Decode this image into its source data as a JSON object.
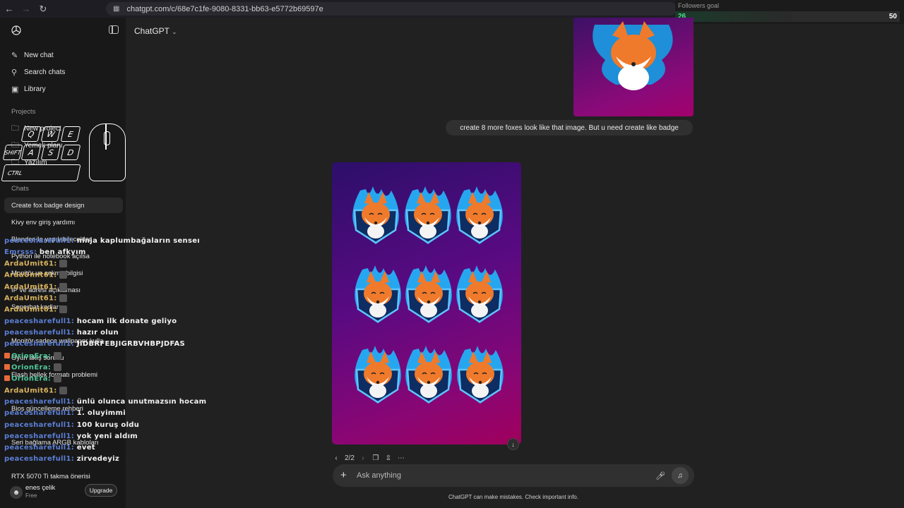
{
  "browser": {
    "url": "chatgpt.com/c/68e7c1fe-9080-8331-bb63-e5772b69597e",
    "back_icon": "back-arrow-icon",
    "forward_icon": "forward-arrow-icon",
    "reload_icon": "reload-icon"
  },
  "followers_goal": {
    "title": "Followers goal",
    "current": "26",
    "goal": "50",
    "progress_fraction": 0.52
  },
  "sidebar": {
    "new_chat": "New chat",
    "search_chats": "Search chats",
    "library": "Library",
    "projects_heading": "Projects",
    "projects": [
      "New project",
      "Yemek planı",
      "Yazılım"
    ],
    "chats_heading": "Chats",
    "chats": [
      "Create fox badge design",
      "Kivy env giriş yardımı",
      "Blender ile yapılabilecekler",
      "Python ile notebook açılsa",
      "Monitör ve sekme bilgisi",
      "IP ve adresi açıklaması",
      "Sonerbat kodları",
      "Monitör sadece wallpaper kulla",
      "Oyun akış sorunu",
      "Flash bellek formatı problemi",
      "Bios güncelleme rehberi",
      "Seri bağlama ARGB kabloları",
      "RTX 5070 Ti takma önerisi"
    ],
    "user_name": "enes çelik",
    "user_plan": "Free",
    "upgrade_label": "Upgrade"
  },
  "main": {
    "model_title": "ChatGPT",
    "user_message": "create 8 more foxes look like that image. But u need create like badge",
    "pager": "2/2",
    "composer_placeholder": "Ask anything",
    "disclaimer": "ChatGPT can make mistakes. Check important info."
  },
  "stream_overlay": {
    "keys": [
      "Q",
      "W",
      "E",
      "SHIFT",
      "A",
      "S",
      "D",
      "CTRL"
    ],
    "chat_lines": [
      {
        "name": "peacesharefull1:",
        "msg": "ninja kaplumbağaların senseı",
        "color": "blue"
      },
      {
        "name": "Emrsss:",
        "msg": "ben afkyım",
        "color": "blue"
      },
      {
        "name": "ArdaUmit61:",
        "msg": "",
        "color": "gold"
      },
      {
        "name": "ArdaUmit61:",
        "msg": "",
        "color": "gold"
      },
      {
        "name": "ArdaUmit61:",
        "msg": "",
        "color": "gold"
      },
      {
        "name": "ArdaUmit61:",
        "msg": "",
        "color": "gold"
      },
      {
        "name": "ArdaUmit61:",
        "msg": "",
        "color": "gold"
      },
      {
        "name": "peacesharefull1:",
        "msg": "hocam ilk donate geliyo",
        "color": "blue"
      },
      {
        "name": "peacesharefull1:",
        "msg": "hazır olun",
        "color": "blue"
      },
      {
        "name": "peacesharefull1:",
        "msg": "JIDBRFEBJIGRBVHBPJDFAS",
        "color": "blue"
      },
      {
        "name": "OrionEra:",
        "msg": "",
        "color": "green"
      },
      {
        "name": "OrionEra:",
        "msg": "",
        "color": "green"
      },
      {
        "name": "OrionEra:",
        "msg": "",
        "color": "green"
      },
      {
        "name": "ArdaUmit61:",
        "msg": "",
        "color": "gold"
      },
      {
        "name": "peacesharefull1:",
        "msg": "ünlü olunca unutmazsın hocam",
        "color": "blue"
      },
      {
        "name": "peacesharefull1:",
        "msg": "1. oluyimmi",
        "color": "blue"
      },
      {
        "name": "peacesharefull1:",
        "msg": "100 kuruş oldu",
        "color": "blue"
      },
      {
        "name": "peacesharefull1:",
        "msg": "yok yeni aldım",
        "color": "blue"
      },
      {
        "name": "peacesharefull1:",
        "msg": "evet",
        "color": "blue"
      },
      {
        "name": "peacesharefull1:",
        "msg": "zirvedeyiz",
        "color": "blue"
      }
    ]
  }
}
